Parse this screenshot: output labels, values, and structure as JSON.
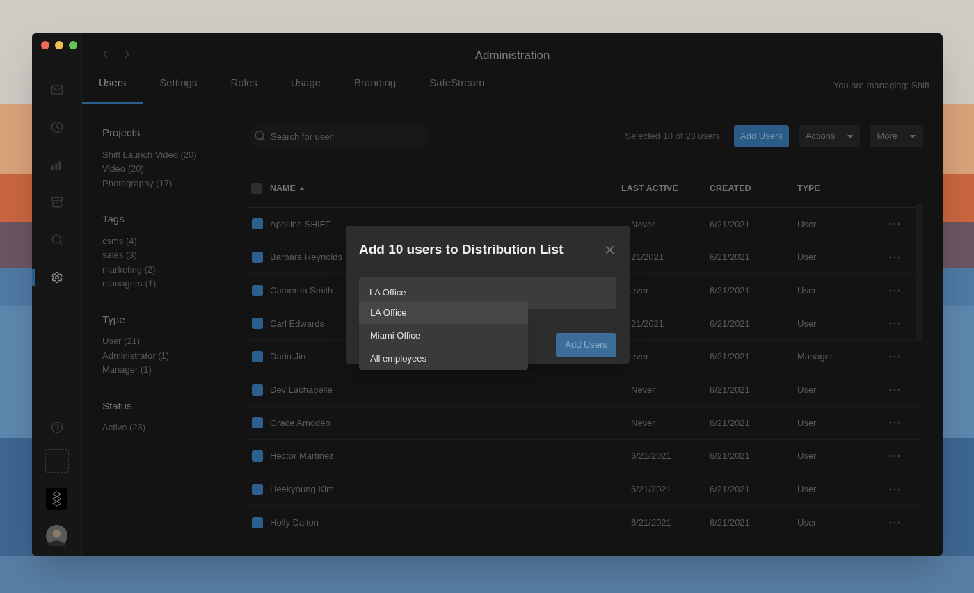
{
  "window": {
    "title": "Administration"
  },
  "rail": [
    {
      "kind": "mail",
      "selected": false
    },
    {
      "kind": "clock",
      "selected": false
    },
    {
      "kind": "chart",
      "selected": false
    },
    {
      "kind": "archive",
      "selected": false
    },
    {
      "kind": "search",
      "selected": false
    },
    {
      "kind": "settings",
      "selected": true
    }
  ],
  "rail_bottom": [
    {
      "kind": "help"
    },
    {
      "kind": "placeholder"
    },
    {
      "kind": "logo"
    },
    {
      "kind": "avatar"
    }
  ],
  "tabs": [
    {
      "label": "Users",
      "selected": true
    },
    {
      "label": "Settings",
      "selected": false
    },
    {
      "label": "Roles",
      "selected": false
    },
    {
      "label": "Usage",
      "selected": false
    },
    {
      "label": "Branding",
      "selected": false
    },
    {
      "label": "SafeStream",
      "selected": false
    }
  ],
  "managing": "You are managing: Shift",
  "filters": [
    {
      "title": "Projects",
      "items": [
        "Shift Launch Video (20)",
        "Video (20)",
        "Photography (17)"
      ]
    },
    {
      "title": "Tags",
      "items": [
        "csms (4)",
        "sales (3)",
        "marketing (2)",
        "managers (1)"
      ]
    },
    {
      "title": "Type",
      "items": [
        "User (21)",
        "Administrator (1)",
        "Manager (1)"
      ]
    },
    {
      "title": "Status",
      "items": [
        "Active (23)"
      ]
    }
  ],
  "search": {
    "placeholder": "Search for user"
  },
  "selection": "Selected 10 of 23 users",
  "toolbar": [
    {
      "label": "Add Users",
      "kind": "primary"
    },
    {
      "label": "Actions",
      "kind": "menu"
    },
    {
      "label": "More",
      "kind": "menu"
    }
  ],
  "table": {
    "header_checked": false,
    "columns": [
      {
        "label": "NAME",
        "sorted": true
      },
      {
        "label": "LAST ACTIVE",
        "sorted": false
      },
      {
        "label": "CREATED",
        "sorted": false
      },
      {
        "label": "TYPE",
        "sorted": false
      }
    ],
    "rows": [
      {
        "checked": true,
        "name": "Apolline SHIFT",
        "last_active": "Never",
        "created": "6/21/2021",
        "type": "User"
      },
      {
        "checked": true,
        "name": "Barbara Reynolds",
        "last_active": "21/2021",
        "created": "6/21/2021",
        "type": "User"
      },
      {
        "checked": true,
        "name": "Cameron Smith",
        "last_active": "ever",
        "created": "6/21/2021",
        "type": "User"
      },
      {
        "checked": true,
        "name": "Carl Edwards",
        "last_active": "21/2021",
        "created": "6/21/2021",
        "type": "User"
      },
      {
        "checked": true,
        "name": "Darin Jin",
        "last_active": "ever",
        "created": "6/21/2021",
        "type": "Manager"
      },
      {
        "checked": true,
        "name": "Dev Lachapelle",
        "last_active": "Never",
        "created": "6/21/2021",
        "type": "User"
      },
      {
        "checked": true,
        "name": "Grace Amodeo",
        "last_active": "Never",
        "created": "6/21/2021",
        "type": "User"
      },
      {
        "checked": true,
        "name": "Hector Martinez",
        "last_active": "6/21/2021",
        "created": "6/21/2021",
        "type": "User"
      },
      {
        "checked": true,
        "name": "Heekyoung Kim",
        "last_active": "6/21/2021",
        "created": "6/21/2021",
        "type": "User"
      },
      {
        "checked": true,
        "name": "Holly Dalton",
        "last_active": "6/21/2021",
        "created": "6/21/2021",
        "type": "User"
      }
    ]
  },
  "modal": {
    "title": "Add 10 users to Distribution List",
    "value": "LA Office",
    "options": [
      {
        "label": "LA Office",
        "selected": true
      },
      {
        "label": "Miami Office",
        "selected": false
      },
      {
        "label": "All employees",
        "selected": false
      }
    ],
    "submit": "Add Users"
  }
}
